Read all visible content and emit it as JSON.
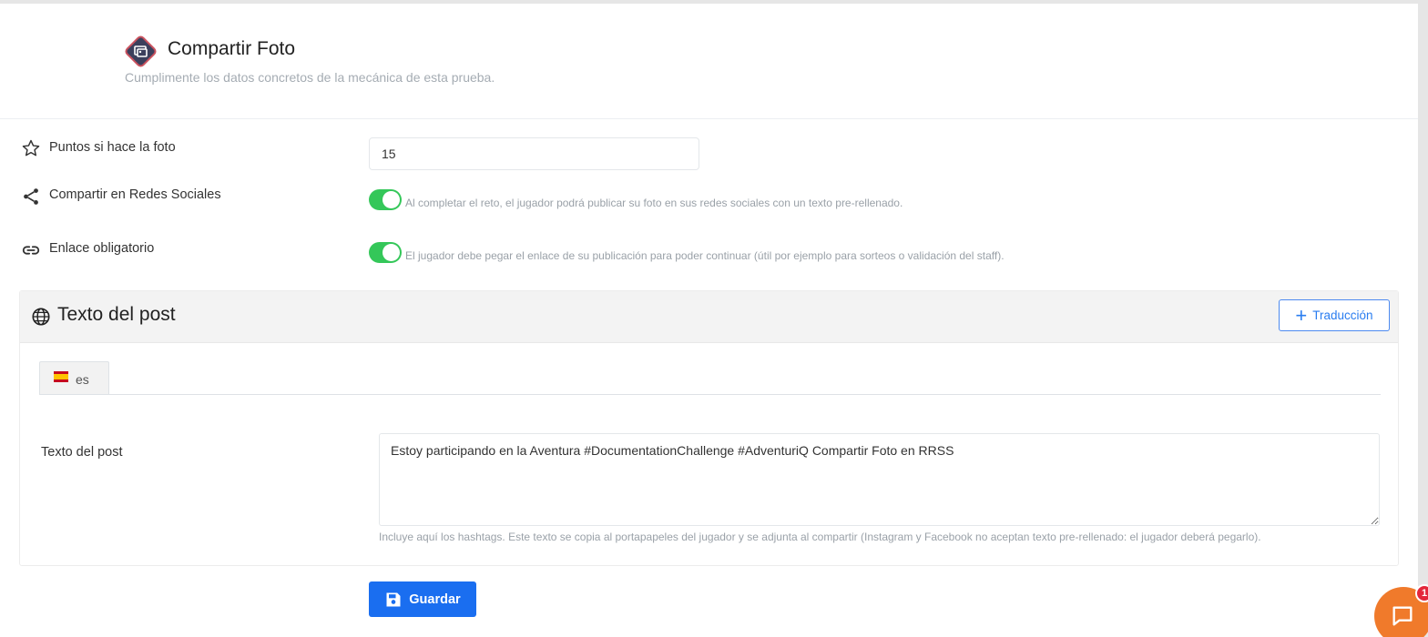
{
  "header": {
    "title": "Compartir Foto",
    "subtitle": "Cumplimente los datos concretos de la mecánica de esta prueba.",
    "icon": "photo-share-diamond-icon"
  },
  "fields": {
    "points": {
      "label": "Puntos si hace la foto",
      "value": "15",
      "icon": "star-icon"
    },
    "share": {
      "label": "Compartir en Redes Sociales",
      "enabled": true,
      "description": "Al completar el reto, el jugador podrá publicar su foto en sus redes sociales con un texto pre-rellenado.",
      "icon": "share-icon"
    },
    "link": {
      "label": "Enlace obligatorio",
      "enabled": true,
      "description": "El jugador debe pegar el enlace de su publicación para poder continuar (útil por ejemplo para sorteos o validación del staff).",
      "icon": "link-icon"
    }
  },
  "post": {
    "title": "Texto del post",
    "translate_button": "Traducción",
    "tabs": [
      {
        "label": "es",
        "flag": "spain-flag-icon"
      }
    ],
    "field_label": "Texto del post",
    "text": "Estoy participando en la Aventura #DocumentationChallenge #AdventuriQ Compartir Foto en RRSS",
    "help": "Incluye aquí los hashtags. Este texto se copia al portapapeles del jugador y se adjunta al compartir (Instagram y Facebook no aceptan texto pre-rellenado: el jugador deberá pegarlo)."
  },
  "save_button": "Guardar",
  "chat": {
    "badge": "1"
  },
  "colors": {
    "toggle_on": "#34c759",
    "primary": "#1a6ef0",
    "chat": "#f07a2b",
    "badge": "#e3263a"
  }
}
